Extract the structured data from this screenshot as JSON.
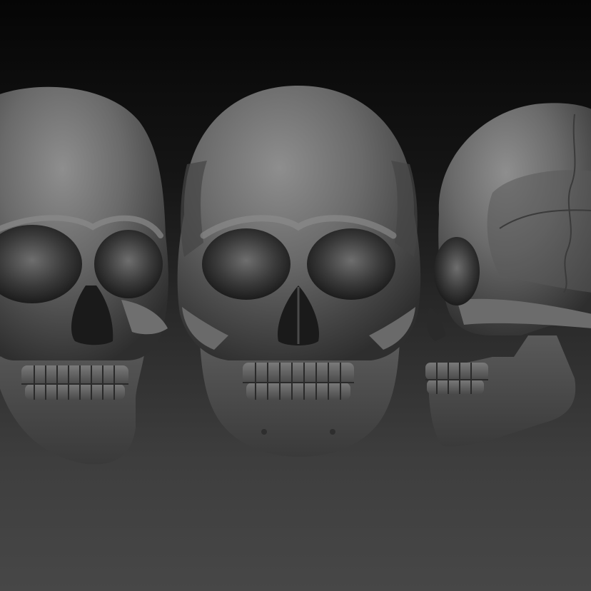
{
  "image": {
    "kind": "3d-sculpt-render",
    "subject": "human-skull",
    "views": [
      "three-quarter-left",
      "front",
      "side-profile"
    ],
    "colors": {
      "background_top": "#050505",
      "background_bottom": "#474747",
      "clay_highlight": "#8a8a8a",
      "clay_mid": "#5e5e5e",
      "clay_shadow": "#2a2a2a"
    }
  }
}
